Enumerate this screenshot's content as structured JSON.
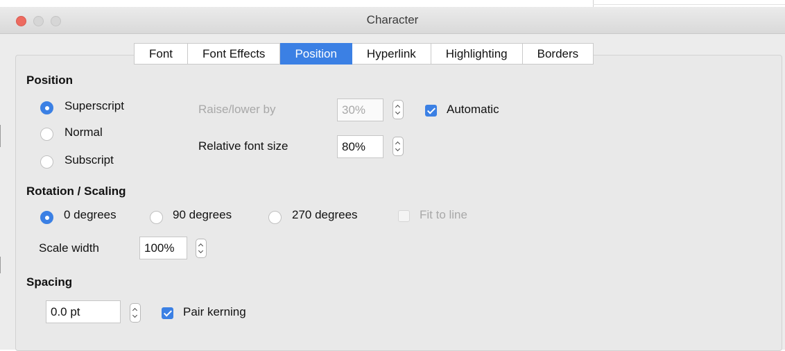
{
  "window": {
    "title": "Character"
  },
  "tabs": [
    "Font",
    "Font Effects",
    "Position",
    "Hyperlink",
    "Highlighting",
    "Borders"
  ],
  "active_tab": "Position",
  "position": {
    "title": "Position",
    "superscript": "Superscript",
    "normal": "Normal",
    "subscript": "Subscript",
    "selected": "Superscript",
    "raise_lower_label": "Raise/lower by",
    "raise_lower_value": "30%",
    "automatic_label": "Automatic",
    "automatic_checked": true,
    "relative_size_label": "Relative font size",
    "relative_size_value": "80%"
  },
  "rotation": {
    "title": "Rotation / Scaling",
    "deg0": "0 degrees",
    "deg90": "90 degrees",
    "deg270": "270 degrees",
    "selected": "0 degrees",
    "fit_to_line": "Fit to line",
    "fit_to_line_checked": false,
    "scale_width_label": "Scale width",
    "scale_width_value": "100%"
  },
  "spacing": {
    "title": "Spacing",
    "value": "0.0 pt",
    "pair_kerning_label": "Pair kerning",
    "pair_kerning_checked": true
  },
  "colors": {
    "accent": "#3b80e4",
    "close_button": "#ed6b60"
  }
}
